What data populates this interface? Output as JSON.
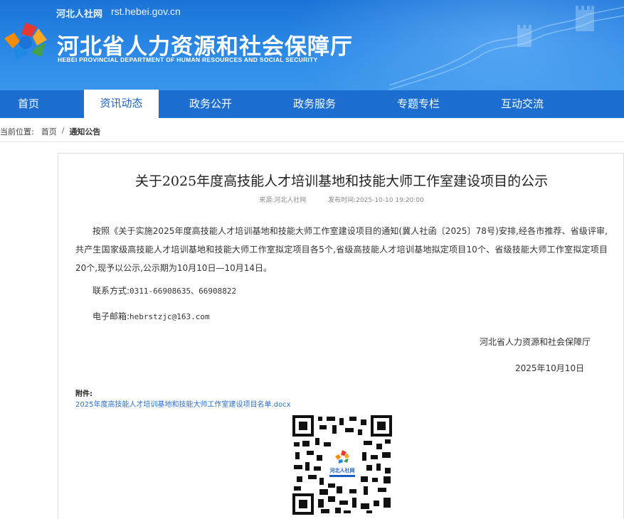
{
  "header": {
    "site_tag": "河北人社网",
    "site_url": "rst.hebei.gov.cn",
    "title_cn": "河北省人力资源和社会保障厅",
    "title_en": "HEBEI PROVINCIAL DEPARTMENT OF HUMAN RESOURCES AND SOCIAL SECURITY"
  },
  "nav": [
    {
      "label": "首页"
    },
    {
      "label": "资讯动态",
      "active": true
    },
    {
      "label": "政务公开"
    },
    {
      "label": "政务服务"
    },
    {
      "label": "专题专栏"
    },
    {
      "label": "互动交流"
    }
  ],
  "breadcrumb": {
    "prefix": "当前位置:",
    "home": "首页",
    "sep": "/",
    "current": "通知公告"
  },
  "article": {
    "title": "关于2025年度高技能人才培训基地和技能大师工作室建设项目的公示",
    "source": "来源:河北人社网",
    "time": "发布时间:2025-10-10 19:20:00",
    "body": "按照《关于实施2025年度高技能人才培训基地和技能大师工作室建设项目的通知(冀人社函〔2025〕78号)安排,经各市推荐、省级评审,共产生国家级高技能人才培训基地和技能大师工作室拟定项目各5个,省级高技能人才培训基地拟定项目10个、省级技能大师工作室拟定项目20个,现予以公示,公示期为10月10日—10月14日。",
    "contact_label": "联系方式:",
    "contact_value": "0311-66908635、66908822",
    "email_label": "电子邮箱:",
    "email_value": "hebrstzjc@163.com",
    "signature": "河北省人力资源和社会保障厅",
    "date": "2025年10月10日",
    "attachment_label": "附件:",
    "attachment_link": "2025年度高技能人才培训基地和技能大师工作室建设项目名单.docx",
    "qr_caption": "河北人社网"
  },
  "colors": {
    "banner": "#1b73d6",
    "nav": "#1c6fd0",
    "link": "#2a6fd0"
  }
}
